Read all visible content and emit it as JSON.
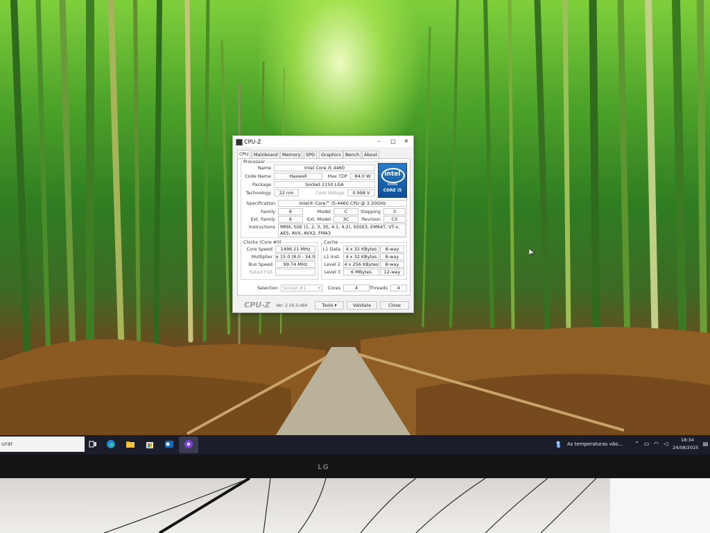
{
  "window": {
    "title": "CPU-Z",
    "tabs": [
      "CPU",
      "Mainboard",
      "Memory",
      "SPD",
      "Graphics",
      "Bench",
      "About"
    ],
    "active_tab": "CPU"
  },
  "processor": {
    "group": "Processor",
    "labels": {
      "name": "Name",
      "code_name": "Code Name",
      "max_tdp": "Max TDP",
      "package": "Package",
      "technology": "Technology",
      "core_voltage": "Core Voltage",
      "specification": "Specification",
      "family": "Family",
      "model": "Model",
      "stepping": "Stepping",
      "ext_family": "Ext. Family",
      "ext_model": "Ext. Model",
      "revision": "Revision",
      "instructions": "Instructions"
    },
    "name": "Intel Core i5 4460",
    "code_name": "Haswell",
    "max_tdp": "84.0 W",
    "package": "Socket 1150 LGA",
    "technology": "22 nm",
    "core_voltage": "0.998 V",
    "specification": "Intel® Core™ i5-4460  CPU @ 3.20GHz",
    "family": "6",
    "model": "C",
    "stepping": "3",
    "ext_family": "6",
    "ext_model": "3C",
    "revision": "C0",
    "instructions": "MMX, SSE (1, 2, 3, 3S, 4.1, 4.2), SSSE3, EM64T, VT-x, AES, AVX, AVX2, FMA3"
  },
  "logo": {
    "brand": "intel",
    "inside": "inside",
    "series": "CORE i5"
  },
  "clocks": {
    "group": "Clocks (Core #0)",
    "labels": {
      "core_speed": "Core Speed",
      "multiplier": "Multiplier",
      "bus_speed": "Bus Speed",
      "rated_fsb": "Rated FSB"
    },
    "core_speed": "1496.11 MHz",
    "multiplier": "x 15.0 (8.0 - 34.0)",
    "bus_speed": "99.74 MHz",
    "rated_fsb": ""
  },
  "cache": {
    "group": "Cache",
    "rows": [
      {
        "label": "L1 Data",
        "size": "4 x 32 KBytes",
        "assoc": "8-way"
      },
      {
        "label": "L1 Inst.",
        "size": "4 x 32 KBytes",
        "assoc": "8-way"
      },
      {
        "label": "Level 2",
        "size": "4 x 256 KBytes",
        "assoc": "8-way"
      },
      {
        "label": "Level 3",
        "size": "6 MBytes",
        "assoc": "12-way"
      }
    ]
  },
  "selection": {
    "label": "Selection",
    "socket": "Socket #1",
    "cores_label": "Cores",
    "cores": "4",
    "threads_label": "Threads",
    "threads": "4"
  },
  "footer": {
    "brand": "CPU-Z",
    "version": "Ver. 2.16.0.x64",
    "tools": "Tools",
    "validate": "Validate",
    "close": "Close"
  },
  "taskbar": {
    "search_text": "urar",
    "weather_text": "As temperaturas vão...",
    "time": "18:34",
    "date": "24/08/2025"
  },
  "monitor": {
    "brand": "LG"
  },
  "icons": {
    "task_view": "task-view-icon",
    "edge": "edge-icon",
    "explorer": "folder-icon",
    "store": "store-icon",
    "outlook": "outlook-icon",
    "app": "app-icon",
    "weather": "weather-icon",
    "tray": [
      "chevron-up-icon",
      "network-icon",
      "wifi-icon",
      "volume-icon",
      "notification-icon"
    ]
  },
  "colors": {
    "taskbar": "#1b1d2a",
    "intel_blue": "#0d4f98",
    "window_bg": "#f1f1f1"
  }
}
